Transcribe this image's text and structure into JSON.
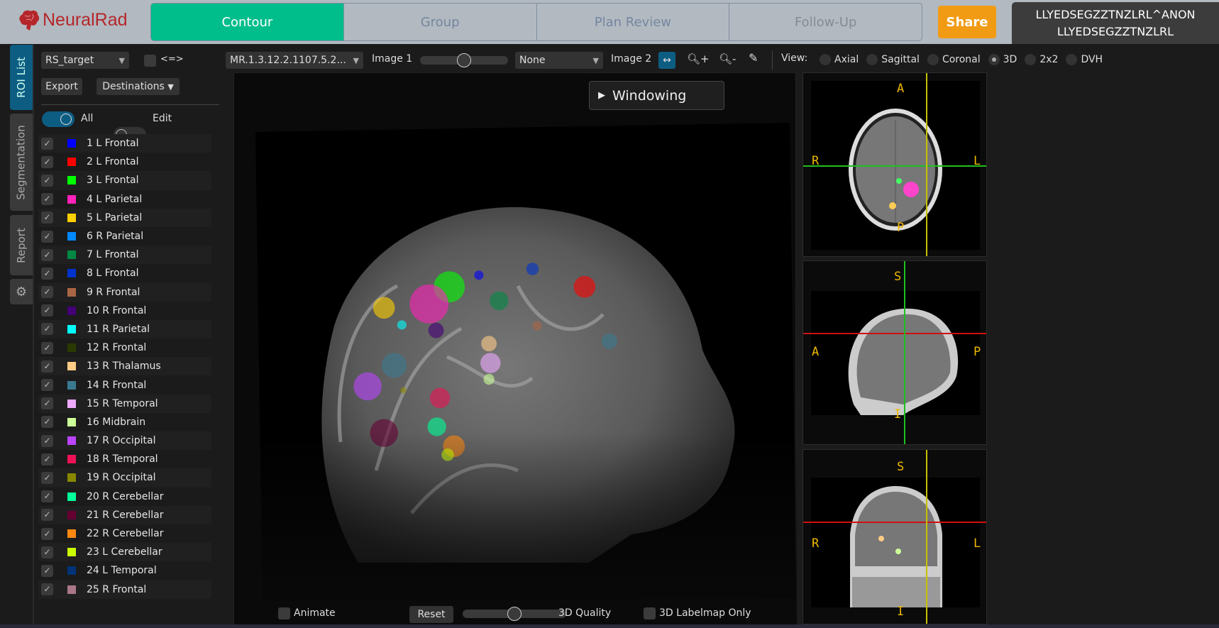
{
  "app": {
    "name": "NeuralRad"
  },
  "nav": {
    "tabs": [
      {
        "label": "Contour",
        "active": true
      },
      {
        "label": "Group"
      },
      {
        "label": "Plan Review"
      },
      {
        "label": "Follow-Up"
      }
    ],
    "share": "Share"
  },
  "patient": {
    "line1": "LLYEDSEGZZTNZLRL^ANON",
    "line2": "LLYEDSEGZZTNZLRL"
  },
  "side_tabs": [
    {
      "label": "ROI List",
      "active": true
    },
    {
      "label": "Segmentation"
    },
    {
      "label": "Report"
    }
  ],
  "left": {
    "structure_set": "RS_target",
    "swap_label": "<=>",
    "export": "Export",
    "destinations": "Destinations",
    "all_label": "All",
    "all_on": true,
    "edit_label": "Edit",
    "edit_on": false
  },
  "rois": [
    {
      "label": "1 L Frontal",
      "color": "#0000ff"
    },
    {
      "label": "2 L Frontal",
      "color": "#ff0000"
    },
    {
      "label": "3 L Frontal",
      "color": "#00ff00"
    },
    {
      "label": "4 L Parietal",
      "color": "#ff22bb"
    },
    {
      "label": "5 L Parietal",
      "color": "#ffd000"
    },
    {
      "label": "6 R Parietal",
      "color": "#0088ff"
    },
    {
      "label": "7 L Frontal",
      "color": "#008844"
    },
    {
      "label": "8 L Frontal",
      "color": "#0033cc"
    },
    {
      "label": "9 R Frontal",
      "color": "#aa6644"
    },
    {
      "label": "10 R Frontal",
      "color": "#440077"
    },
    {
      "label": "11 R Parietal",
      "color": "#00ffff"
    },
    {
      "label": "12 R Frontal",
      "color": "#2a3a00"
    },
    {
      "label": "13 R Thalamus",
      "color": "#ffcc88"
    },
    {
      "label": "14 R Frontal",
      "color": "#3a7a90"
    },
    {
      "label": "15 R Temporal",
      "color": "#eeaaff"
    },
    {
      "label": "16 Midbrain",
      "color": "#ccff99"
    },
    {
      "label": "17 R Occipital",
      "color": "#bb44ff"
    },
    {
      "label": "18 R Temporal",
      "color": "#ee1155"
    },
    {
      "label": "19 R Occipital",
      "color": "#888800"
    },
    {
      "label": "20 R Cerebellar",
      "color": "#00ff99"
    },
    {
      "label": "21 R Cerebellar",
      "color": "#660033"
    },
    {
      "label": "22 R Cerebellar",
      "color": "#ff8811"
    },
    {
      "label": "23 L Cerebellar",
      "color": "#ccff00"
    },
    {
      "label": "24 L Temporal",
      "color": "#003377"
    },
    {
      "label": "25 R Frontal",
      "color": "#aa7788"
    }
  ],
  "toolbar": {
    "image1_series": "MR.1.3.12.2.1107.5.2...",
    "image1_label": "Image 1",
    "image1_blend": 0.5,
    "image2_series": "None",
    "image2_label": "Image 2",
    "view_label": "View:",
    "views": [
      {
        "label": "Axial"
      },
      {
        "label": "Sagittal"
      },
      {
        "label": "Coronal"
      },
      {
        "label": "3D",
        "selected": true
      },
      {
        "label": "2x2"
      },
      {
        "label": "DVH"
      }
    ]
  },
  "viewer": {
    "windowing": "Windowing",
    "animate": "Animate",
    "reset": "Reset",
    "quality_label": "3D Quality",
    "quality": 0.5,
    "labelmap_only": "3D Labelmap Only"
  },
  "panels": {
    "axial": {
      "top": "A",
      "left": "R",
      "right": "L",
      "bottom": "P"
    },
    "sagittal": {
      "top": "S",
      "left": "A",
      "right": "P",
      "bottom": "I"
    },
    "coronal": {
      "top": "S",
      "left": "R",
      "right": "L",
      "bottom": "I"
    }
  },
  "colors": {
    "accent": "#00bd8c",
    "share": "#f19b14",
    "active_tab": "#0d5d83",
    "orientation": "#f0b800"
  }
}
